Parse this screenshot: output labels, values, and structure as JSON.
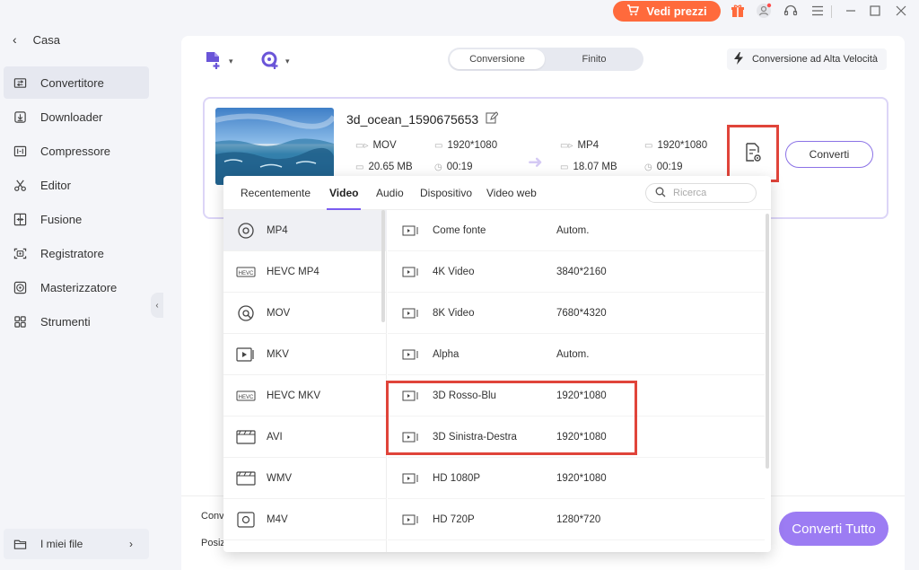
{
  "sidebar": {
    "back_label": "Casa",
    "items": [
      {
        "label": "Convertitore",
        "icon": "convert-icon",
        "active": true
      },
      {
        "label": "Downloader",
        "icon": "download-icon",
        "active": false
      },
      {
        "label": "Compressore",
        "icon": "compress-icon",
        "active": false
      },
      {
        "label": "Editor",
        "icon": "scissors-icon",
        "active": false
      },
      {
        "label": "Fusione",
        "icon": "merge-icon",
        "active": false
      },
      {
        "label": "Registratore",
        "icon": "record-icon",
        "active": false
      },
      {
        "label": "Masterizzatore",
        "icon": "disc-icon",
        "active": false
      },
      {
        "label": "Strumenti",
        "icon": "grid-icon",
        "active": false
      }
    ],
    "my_files": "I miei file"
  },
  "titlebar": {
    "price_button": "Vedi prezzi",
    "icons": [
      "cart-icon",
      "gift-icon",
      "user-icon",
      "headset-icon",
      "menu-icon",
      "minimize-icon",
      "maximize-icon",
      "close-icon"
    ]
  },
  "toolbar": {
    "tabs": [
      "Conversione",
      "Finito"
    ],
    "speed_label": "Conversione ad Alta Velocità"
  },
  "file": {
    "name": "3d_ocean_1590675653",
    "source": {
      "format": "MOV",
      "resolution": "1920*1080",
      "size": "20.65 MB",
      "duration": "00:19"
    },
    "target": {
      "format": "MP4",
      "resolution": "1920*1080",
      "size": "18.07 MB",
      "duration": "00:19"
    },
    "convert_label": "Converti"
  },
  "bottom": {
    "line1": "Conv",
    "line2": "Posiz",
    "convert_all": "Converti Tutto"
  },
  "dropdown": {
    "tabs": [
      "Recentemente",
      "Video",
      "Audio",
      "Dispositivo",
      "Video web"
    ],
    "active_tab": "Video",
    "search_placeholder": "Ricerca",
    "formats": [
      "MP4",
      "HEVC MP4",
      "MOV",
      "MKV",
      "HEVC MKV",
      "AVI",
      "WMV",
      "M4V"
    ],
    "selected_format": "MP4",
    "resolutions": [
      {
        "name": "Come fonte",
        "value": "Autom."
      },
      {
        "name": "4K Video",
        "value": "3840*2160"
      },
      {
        "name": "8K Video",
        "value": "7680*4320"
      },
      {
        "name": "Alpha",
        "value": "Autom."
      },
      {
        "name": "3D Rosso-Blu",
        "value": "1920*1080"
      },
      {
        "name": "3D Sinistra-Destra",
        "value": "1920*1080"
      },
      {
        "name": "HD 1080P",
        "value": "1920*1080"
      },
      {
        "name": "HD 720P",
        "value": "1280*720"
      }
    ]
  },
  "colors": {
    "accent": "#8b72e6",
    "price_button": "#ff6a3c",
    "highlight": "#e0443a",
    "convert_all": "#9c7cf3"
  }
}
